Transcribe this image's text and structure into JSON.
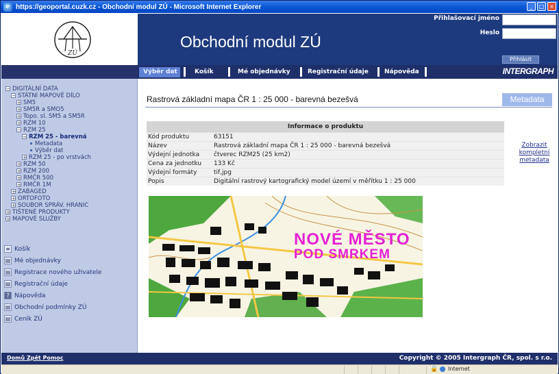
{
  "window": {
    "title": "https://geoportal.cuzk.cz - Obchodní modul ZÚ - Microsoft Internet Explorer"
  },
  "header": {
    "logo_text": "ZÚ",
    "brand_title": "Obchodní modul ZÚ",
    "login_label": "Přihlašovací jméno",
    "password_label": "Heslo",
    "login_button": "Přihlásit",
    "login_value": "",
    "password_value": ""
  },
  "nav": {
    "items": [
      {
        "label": "Výběr dat",
        "active": true
      },
      {
        "label": "Košík",
        "active": false
      },
      {
        "label": "Mé objednávky",
        "active": false
      },
      {
        "label": "Registrační údaje",
        "active": false
      },
      {
        "label": "Nápověda",
        "active": false
      }
    ],
    "brand": "INTERGRAPH"
  },
  "sidebar": {
    "tree": [
      {
        "label": "DIGITÁLNÍ DATA",
        "box": "⊟"
      },
      {
        "label": "STÁTNÍ MAPOVÉ DÍLO",
        "box": "⊟"
      },
      {
        "label": "SM5",
        "box": "⊞"
      },
      {
        "label": "SM5R a SMO5",
        "box": "⊞"
      },
      {
        "label": "Topo. sl. SM5 a SM5R",
        "box": "⊞"
      },
      {
        "label": "RZM 10",
        "box": "⊞"
      },
      {
        "label": "RZM 25",
        "box": "⊟"
      },
      {
        "label": "RZM 25 - barevná",
        "box": "⊟"
      },
      {
        "label": "Metadata",
        "box": ""
      },
      {
        "label": "Výběr dat",
        "box": ""
      },
      {
        "label": "RZM 25 - po vrstvách",
        "box": "⊞"
      },
      {
        "label": "RZM 50",
        "box": "⊞"
      },
      {
        "label": "RZM 200",
        "box": "⊞"
      },
      {
        "label": "RMČR 500",
        "box": "⊞"
      },
      {
        "label": "RMČR 1M",
        "box": "⊞"
      },
      {
        "label": "ZABAGED",
        "box": "⊞"
      },
      {
        "label": "ORTOFOTO",
        "box": "⊞"
      },
      {
        "label": "SOUBOR SPRÁV. HRANIC",
        "box": "⊞"
      },
      {
        "label": "TIŠTENÉ PRODUKTY",
        "box": "⊞"
      },
      {
        "label": "MAPOVÉ SLUŽBY",
        "box": "⊞"
      }
    ],
    "links": [
      {
        "label": "Košík",
        "icon": "cart-icon"
      },
      {
        "label": "Mé objednávky",
        "icon": "orders-icon"
      },
      {
        "label": "Registrace nového uživatele",
        "icon": "register-icon"
      },
      {
        "label": "Registrační údaje",
        "icon": "profile-icon"
      },
      {
        "label": "Nápověda",
        "icon": "help-icon"
      },
      {
        "label": "Obchodní podmínky ZÚ",
        "icon": "terms-icon"
      },
      {
        "label": "Ceník ZÚ",
        "icon": "pricelist-icon"
      }
    ]
  },
  "main": {
    "title": "Rastrová základní mapa ČR 1 : 25 000 - barevná bezešvá",
    "metadata_button": "Metadata",
    "info_header": "Informace o produktu",
    "info": [
      {
        "key": "Kód produktu",
        "value": "63151"
      },
      {
        "key": "Název",
        "value": "Rastrová základní mapa ČR 1 : 25 000 - barevná bezešvá"
      },
      {
        "key": "Výdejní jednotka",
        "value": "čtverec RZM25 (25 km2)"
      },
      {
        "key": "Cena za jednotku",
        "value": "133 Kč"
      },
      {
        "key": "Výdejní formáty",
        "value": "tif,jpg"
      },
      {
        "key": "Popis",
        "value": "Digitální rastrový kartografický model území v měřítku 1 : 25 000"
      }
    ],
    "complete_metadata_link": "Zobrazit kompletní metadata",
    "map_label_line1": "NOVÉ MĚSTO",
    "map_label_line2": "POD SMRKEM"
  },
  "footer": {
    "links": "Domů  Zpět  Pomoc",
    "copyright": "Copyright © 2005 Intergraph ČR, spol. s r.o."
  },
  "statusbar": {
    "zone": "Internet"
  }
}
